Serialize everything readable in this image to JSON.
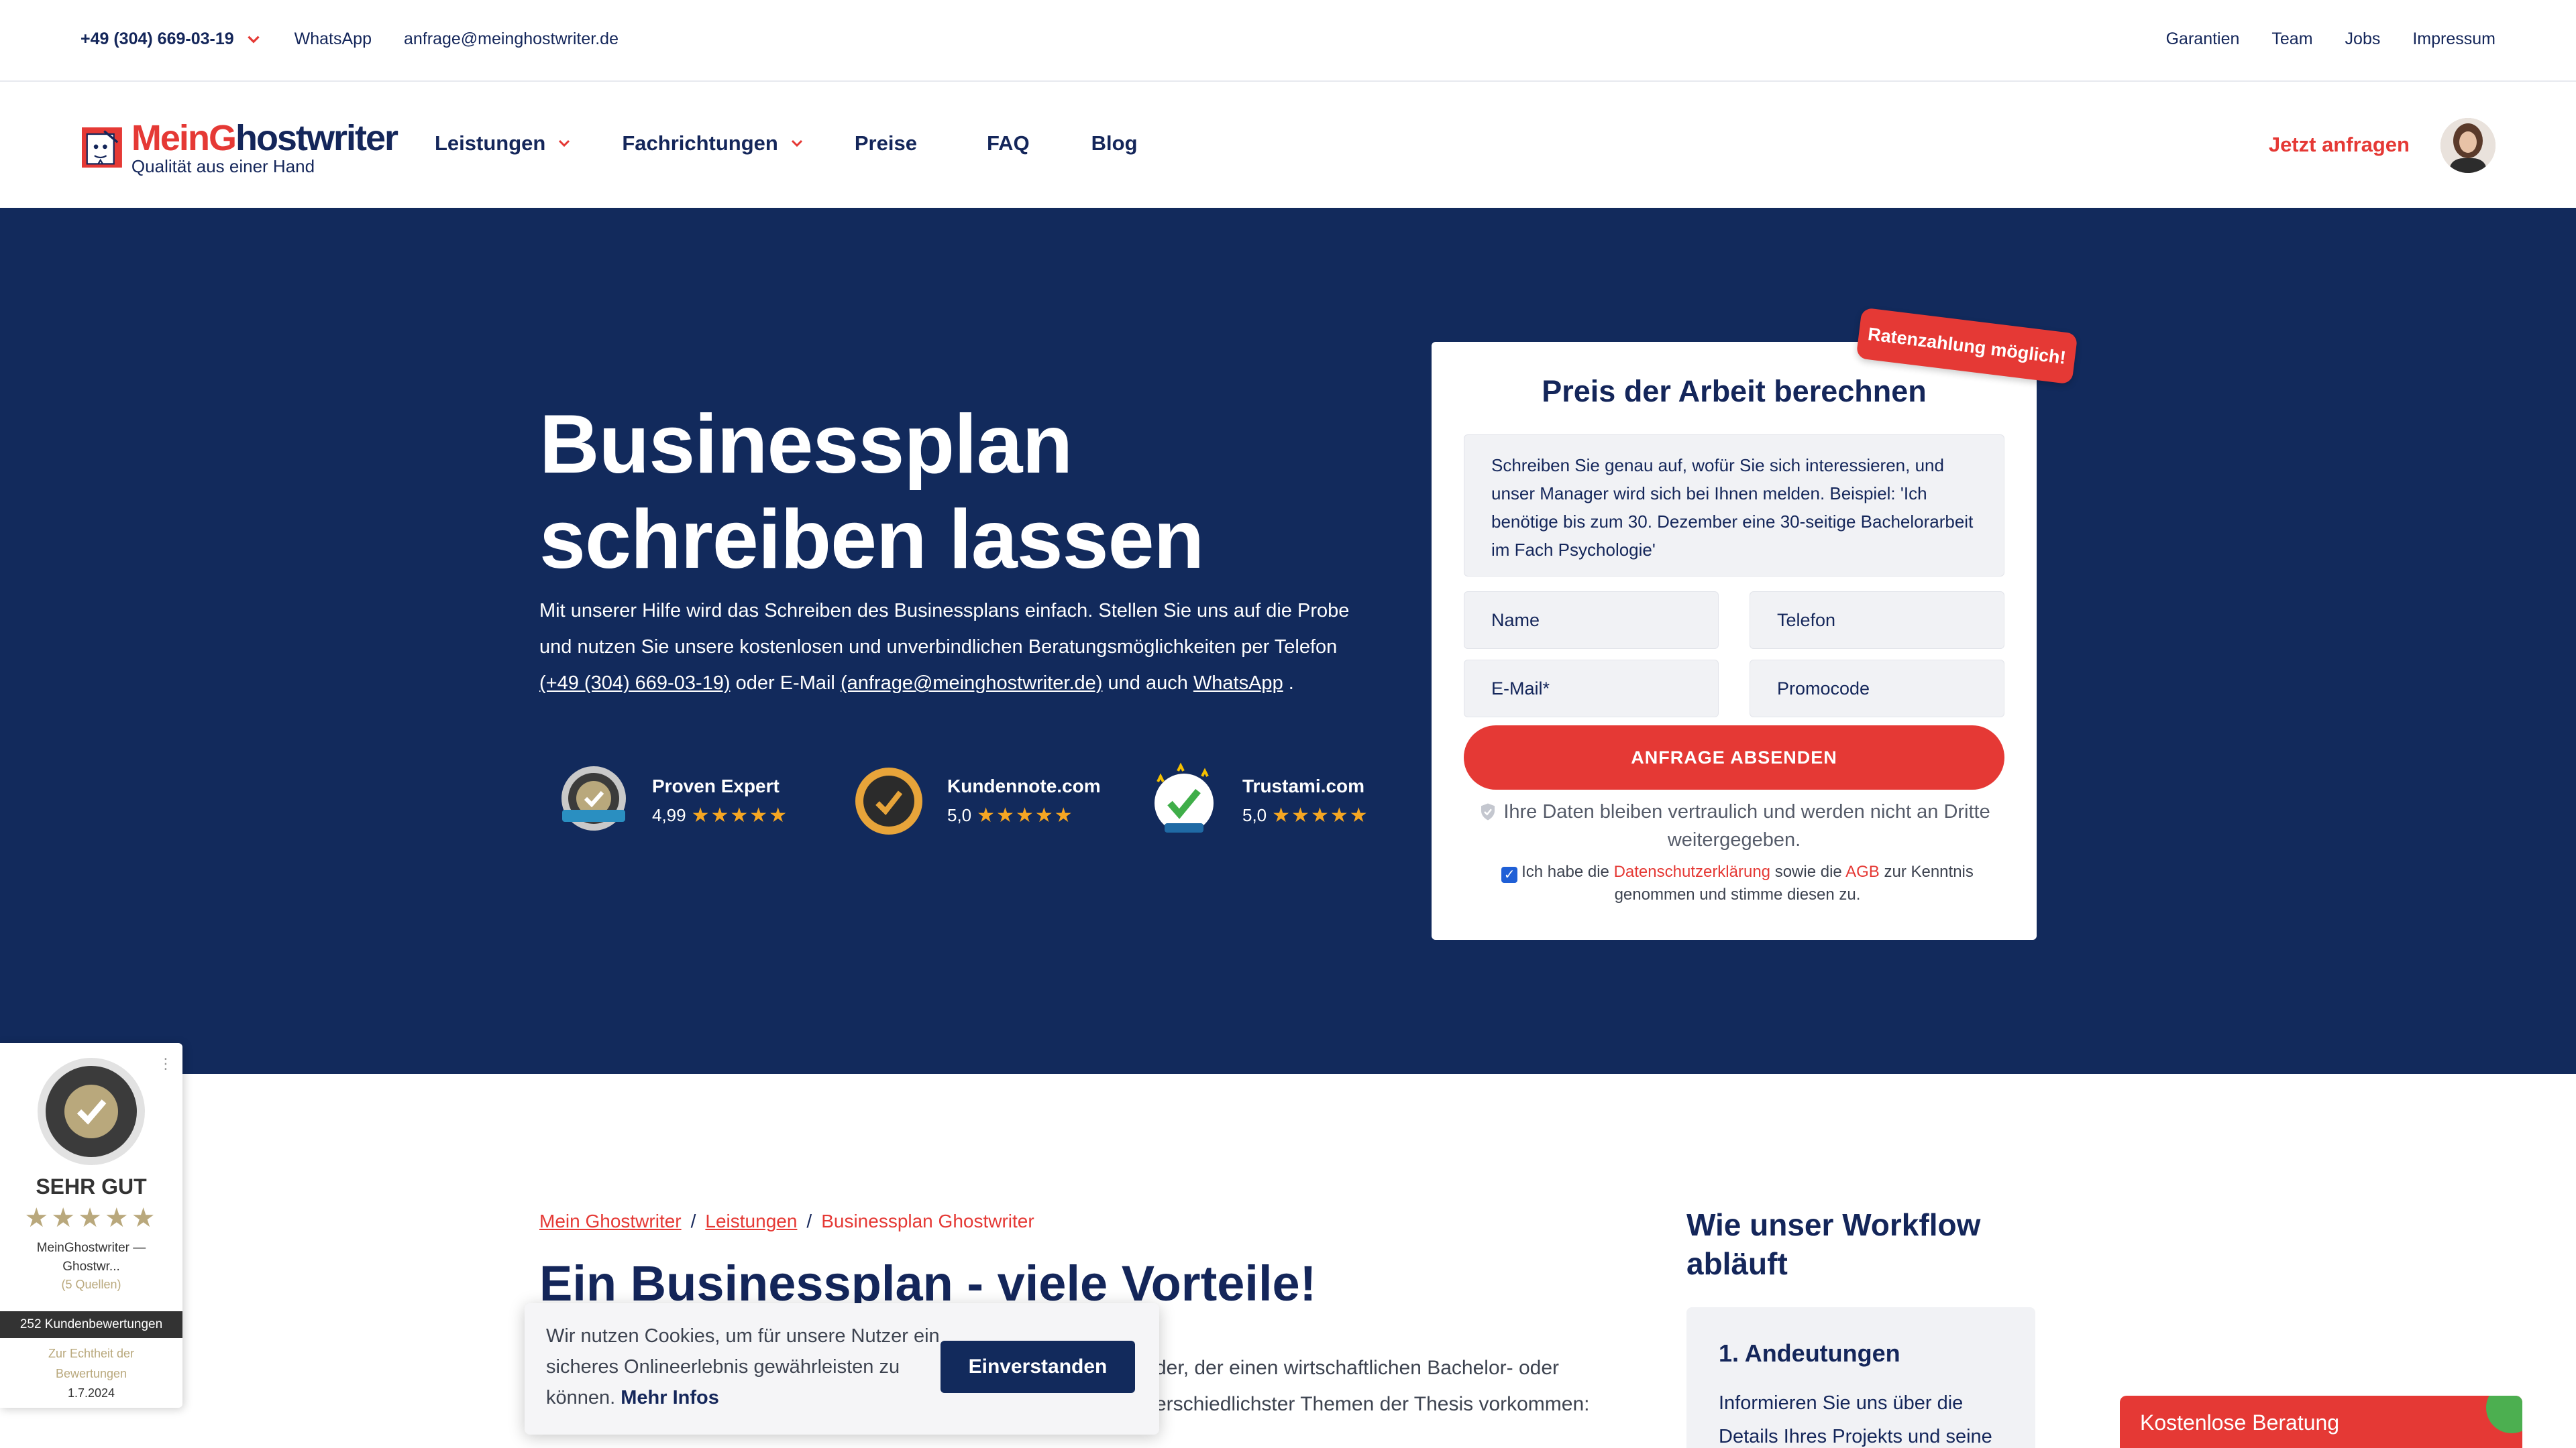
{
  "colors": {
    "navy": "#122a5c",
    "accent": "#e53935",
    "text": "#14265a"
  },
  "topbar": {
    "phone": "+49 (304) 669-03-19",
    "whatsapp": "WhatsApp",
    "email": "anfrage@meinghostwriter.de",
    "links": [
      "Garantien",
      "Team",
      "Jobs",
      "Impressum"
    ]
  },
  "nav": {
    "logo_name_prefix": "Mein",
    "logo_name_g": "G",
    "logo_name_rest": "hostwriter",
    "logo_tagline": "Qualität aus einer Hand",
    "items": [
      "Leistungen",
      "Fachrichtungen",
      "Preise",
      "FAQ",
      "Blog"
    ],
    "cta": "Jetzt anfragen"
  },
  "hero": {
    "title": "Businessplan schreiben lassen",
    "text_1": "Mit unserer Hilfe wird das Schreiben des Businessplans einfach. Stellen Sie uns auf die Probe und nutzen Sie unsere kostenlosen und unverbindlichen Beratungsmöglichkeiten per Telefon ",
    "phone_link": "(+49 (304) 669-03-19)",
    "text_2": " oder E-Mail ",
    "email_link": "(anfrage@meinghostwriter.de)",
    "text_3": " und auch ",
    "whatsapp_link": "WhatsApp",
    "text_4": " .",
    "ratings": [
      {
        "name": "Proven Expert",
        "score": "4,99",
        "stars": "★★★★★"
      },
      {
        "name": "Kundennote.com",
        "score": "5,0",
        "stars": "★★★★★"
      },
      {
        "name": "Trustami.com",
        "score": "5,0",
        "stars": "★★★★★"
      }
    ]
  },
  "form": {
    "ribbon": "Ratenzahlung möglich!",
    "title": "Preis der Arbeit berechnen",
    "message_placeholder": "Schreiben Sie genau auf, wofür Sie sich interessieren, und unser Manager wird sich bei Ihnen melden. Beispiel: 'Ich benötige bis zum 30. Dezember eine 30-seitige Bachelorarbeit im Fach Psychologie'",
    "name_placeholder": "Name",
    "phone_placeholder": "Telefon",
    "email_placeholder": "E-Mail*",
    "promo_placeholder": "Promocode",
    "submit": "ANFRAGE ABSENDEN",
    "privacy_note": "Ihre Daten bleiben vertraulich und werden nicht an Dritte weitergegeben.",
    "consent_1": "Ich habe die ",
    "consent_link_1": "Datenschutzerklärung",
    "consent_2": " sowie die ",
    "consent_link_2": "AGB",
    "consent_3": " zur Kenntnis genommen und stimme diesen zu."
  },
  "content": {
    "breadcrumb": [
      "Mein Ghostwriter",
      "Leistungen",
      "Businessplan Ghostwriter"
    ],
    "breadcrumb_sep": "/",
    "section_title": "Ein Businessplan - viele Vorteile!",
    "line_1": "der, der einen wirtschaftlichen Bachelor- oder",
    "line_2": "erschiedlichster Themen der Thesis vorkommen:",
    "side_title": "Wie unser Workflow abläuft",
    "side_box_title": "1. Andeutungen",
    "side_box_text": "Informieren Sie uns über die Details Ihres Projekts und seine"
  },
  "cookie": {
    "text": "Wir nutzen Cookies, um für unsere Nutzer ein sicheres Onlineerlebnis gewährleisten zu können. ",
    "more": "Mehr Infos",
    "button": "Einverstanden"
  },
  "proven_expert_widget": {
    "grade": "SEHR GUT",
    "stars": "★★★★★",
    "name": "MeinGhostwriter — Ghostwr...",
    "sources": "(5 Quellen)",
    "count": "252 Kundenbewertungen",
    "link": "Zur Echtheit der Bewertungen",
    "date": "1.7.2024"
  },
  "chat": {
    "label": "Kostenlose Beratung"
  }
}
